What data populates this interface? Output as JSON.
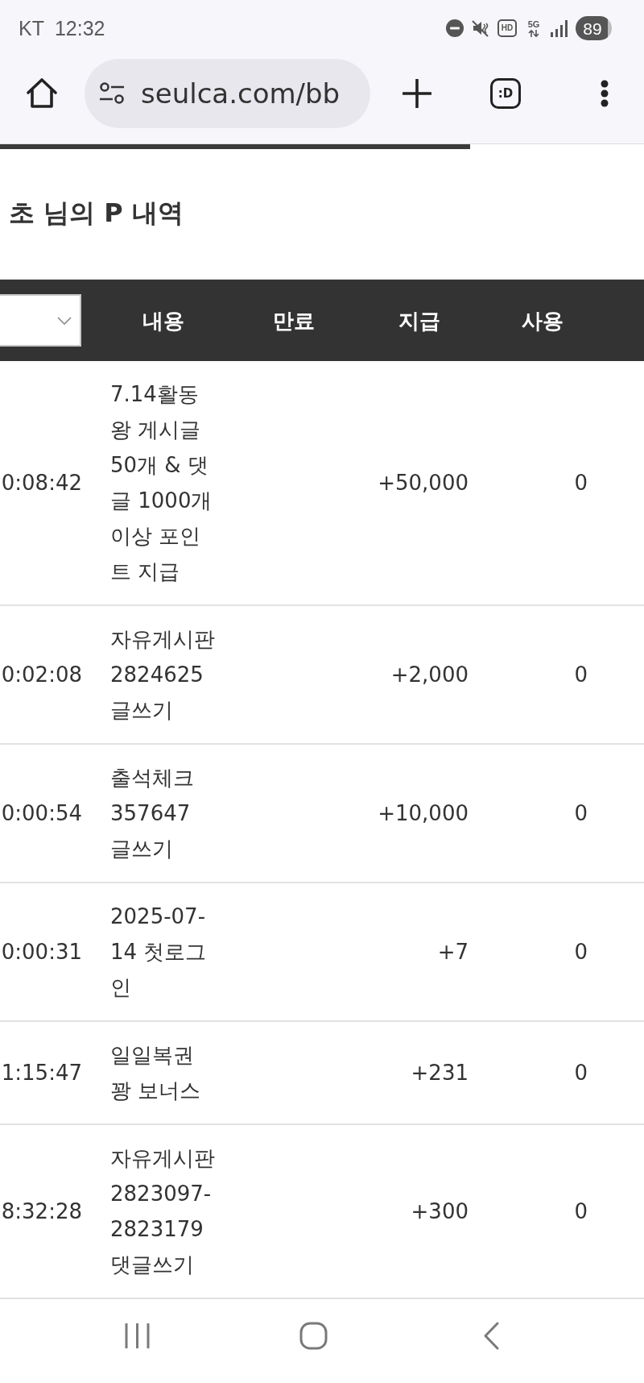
{
  "status_bar": {
    "carrier": "KT",
    "time": "12:32",
    "indicators": [
      {
        "kind": "hd",
        "label": "HD"
      },
      {
        "kind": "network",
        "label": "5G"
      }
    ],
    "battery": "89"
  },
  "browser_toolbar": {
    "url": "seulca.com/bb",
    "tab_switcher": ":D",
    "load_progress": {
      "level": 0.73
    }
  },
  "title": "초 님의 P 내역",
  "table": {
    "columns": [
      {
        "kind": "select"
      },
      {
        "kind": "heading",
        "label": "내용"
      },
      {
        "kind": "heading",
        "label": "만료"
      },
      {
        "kind": "heading",
        "label": "지급"
      },
      {
        "kind": "heading",
        "label": "사용"
      }
    ],
    "rows": [
      {
        "column_1": "0:08:42",
        "content": "7.14활동왕 게시글 50개 & 댓글 1000개 이상 포인트 지급",
        "granted": "+50,000",
        "used": "0"
      },
      {
        "column_1": "0:02:08",
        "content": "자유게시판 2824625 글쓰기",
        "granted": "+2,000",
        "used": "0"
      },
      {
        "column_1": "0:00:54",
        "content": "출석체크 357647 글쓰기",
        "granted": "+10,000",
        "used": "0"
      },
      {
        "column_1": "0:00:31",
        "content": "2025-07-14 첫로그인",
        "granted": "+7",
        "used": "0"
      },
      {
        "column_1": "1:15:47",
        "content": "일일복권 꽝 보너스",
        "granted": "+231",
        "used": "0"
      },
      {
        "column_1": "8:32:28",
        "content": "자유게시판 2823097-2823179 댓글쓰기",
        "granted": "+300",
        "used": "0"
      }
    ]
  }
}
